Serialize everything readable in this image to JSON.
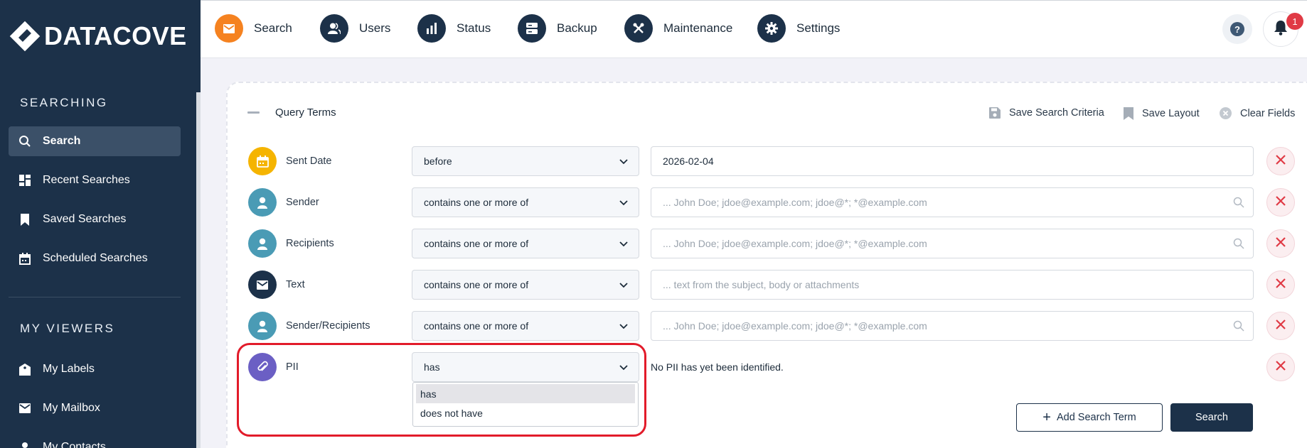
{
  "app": {
    "logo_text": "DATACOVE"
  },
  "sidebar": {
    "section_searching": "SEARCHING",
    "searching_items": [
      {
        "label": "Search",
        "icon": "search-icon",
        "active": true
      },
      {
        "label": "Recent Searches",
        "icon": "dashboard-icon"
      },
      {
        "label": "Saved Searches",
        "icon": "bookmark-icon"
      },
      {
        "label": "Scheduled Searches",
        "icon": "calendar-icon"
      }
    ],
    "section_viewers": "MY VIEWERS",
    "viewer_items": [
      {
        "label": "My Labels",
        "icon": "label-icon"
      },
      {
        "label": "My Mailbox",
        "icon": "mail-icon"
      },
      {
        "label": "My Contacts",
        "icon": "contacts-icon"
      }
    ]
  },
  "topnav": {
    "items": [
      {
        "label": "Search",
        "icon": "mail-icon",
        "active": true
      },
      {
        "label": "Users",
        "icon": "users-icon"
      },
      {
        "label": "Status",
        "icon": "bar-chart-icon"
      },
      {
        "label": "Backup",
        "icon": "server-icon"
      },
      {
        "label": "Maintenance",
        "icon": "tools-icon"
      },
      {
        "label": "Settings",
        "icon": "gear-icon"
      }
    ],
    "help_label": "?",
    "notification_count": "1"
  },
  "query": {
    "title": "Query Terms",
    "actions": {
      "save_criteria": "Save Search Criteria",
      "save_layout": "Save Layout",
      "clear_fields": "Clear Fields"
    },
    "rows": [
      {
        "label": "Sent Date",
        "operator": "before",
        "value": "2026-02-04",
        "placeholder": "",
        "icon": "calendar-icon",
        "icon_color": "#f5b400"
      },
      {
        "label": "Sender",
        "operator": "contains one or more of",
        "value": "",
        "placeholder": "... John Doe; jdoe@example.com; jdoe@*; *@example.com",
        "icon": "person-icon",
        "icon_color": "#4a9bb5"
      },
      {
        "label": "Recipients",
        "operator": "contains one or more of",
        "value": "",
        "placeholder": "... John Doe; jdoe@example.com; jdoe@*; *@example.com",
        "icon": "person-icon",
        "icon_color": "#4a9bb5"
      },
      {
        "label": "Text",
        "operator": "contains one or more of",
        "value": "",
        "placeholder": "... text from the subject, body or attachments",
        "icon": "mail-icon",
        "icon_color": "#1c3149"
      },
      {
        "label": "Sender/Recipients",
        "operator": "contains one or more of",
        "value": "",
        "placeholder": "... John Doe; jdoe@example.com; jdoe@*; *@example.com",
        "icon": "person-icon",
        "icon_color": "#4a9bb5"
      },
      {
        "label": "PII",
        "operator": "has",
        "note": "No PII has yet been identified.",
        "icon": "paperclip-icon",
        "icon_color": "#6b5fc4"
      }
    ],
    "pii_dropdown_options": [
      "has",
      "does not have"
    ],
    "add_term_label": "Add Search Term",
    "search_label": "Search"
  }
}
